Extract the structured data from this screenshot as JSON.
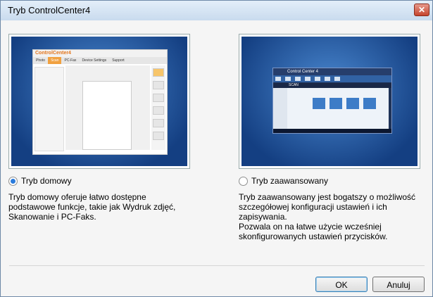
{
  "window": {
    "title": "Tryb ControlCenter4",
    "close_glyph": "✕"
  },
  "home": {
    "radio_label": "Tryb domowy",
    "selected": true,
    "description": "Tryb domowy oferuje łatwo dostępne podstawowe funkcje, takie jak Wydruk zdjęć, Skanowanie i PC-Faks.",
    "preview": {
      "logo": "ControlCenter4",
      "tabs": [
        "Photo",
        "Scan",
        "PC-Fax",
        "Device Settings",
        "Support"
      ]
    }
  },
  "advanced": {
    "radio_label": "Tryb zaawansowany",
    "selected": false,
    "description": "Tryb zaawansowany jest bogatszy o możliwość szczegółowej konfiguracji ustawień i ich zapisywania.\nPozwala on na łatwe użycie wcześniej skonfigurowanych ustawień przycisków.",
    "preview": {
      "logo": "Control Center 4",
      "section": "SCAN"
    }
  },
  "buttons": {
    "ok": "OK",
    "cancel": "Anuluj"
  },
  "colors": {
    "accent": "#2a7bdc",
    "preview_bg": "#143f82",
    "home_accent": "#f1a140"
  }
}
